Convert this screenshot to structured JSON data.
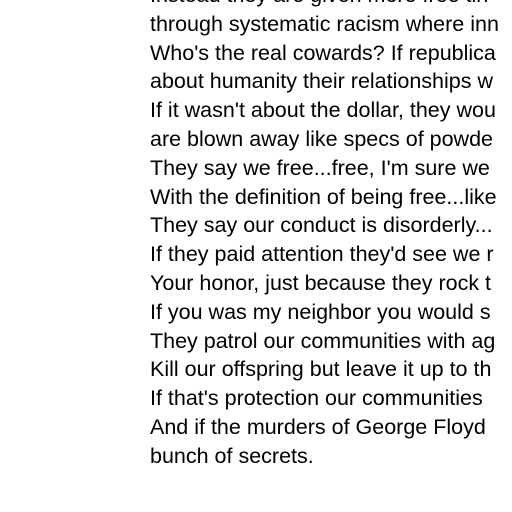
{
  "document": {
    "lines": [
      "Instead they are given more free tin",
      "through systematic racism where inn",
      "Who's the real cowards? If republica",
      "about humanity their relationships w",
      "If it wasn't about the dollar, they wou",
      "are blown away like specs of powde",
      "They say we free...free, I'm sure we",
      "With the definition of being free...like",
      "They say our conduct is disorderly...",
      "If they paid attention they'd see we r",
      "Your honor, just because they rock t",
      "If you was my neighbor you would s",
      "They patrol our communities with ag",
      "Kill our offspring but leave it up to th",
      "If that's protection our communities",
      "And if the murders of George Floyd",
      "bunch of secrets."
    ]
  }
}
